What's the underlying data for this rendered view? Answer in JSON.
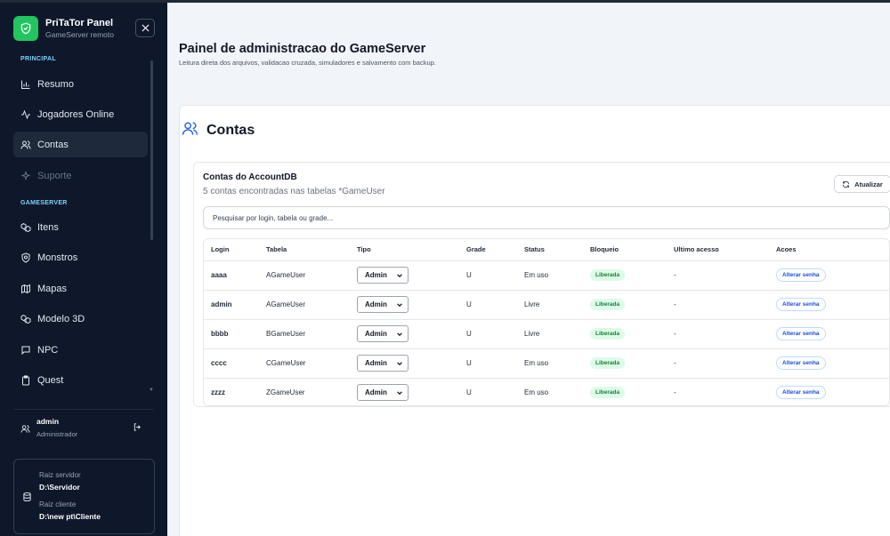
{
  "brand": {
    "title": "PriTaTor Panel",
    "subtitle": "GameServer remoto"
  },
  "sidebar": {
    "section_principal": "PRINCIPAL",
    "section_gameserver": "GAMESERVER",
    "items": [
      {
        "label": "Resumo",
        "icon": "bar-chart-icon"
      },
      {
        "label": "Jogadores Online",
        "icon": "activity-icon"
      },
      {
        "label": "Contas",
        "icon": "users-icon"
      },
      {
        "label": "Suporte",
        "icon": "sparkle-icon"
      },
      {
        "label": "Itens",
        "icon": "boxes-icon"
      },
      {
        "label": "Monstros",
        "icon": "shield-icon"
      },
      {
        "label": "Mapas",
        "icon": "map-icon"
      },
      {
        "label": "Modelo 3D",
        "icon": "boxes-icon"
      },
      {
        "label": "NPC",
        "icon": "message-icon"
      },
      {
        "label": "Quest",
        "icon": "clipboard-icon"
      }
    ],
    "user": {
      "name": "admin",
      "role": "Administrador"
    },
    "paths": {
      "server_label": "Raiz servidor",
      "server_value": "D:\\Servidor",
      "client_label": "Raiz cliente",
      "client_value": "D:\\new pt\\Cliente"
    }
  },
  "header": {
    "title": "Painel de administracao do GameServer",
    "subtitle": "Leitura direta dos arquivos, validacao cruzada, simuladores e salvamento com backup."
  },
  "card": {
    "title": "Contas"
  },
  "panel": {
    "title": "Contas do AccountDB",
    "subtitle": "5 contas encontradas nas tabelas *GameUser",
    "refresh_label": "Atualizar",
    "search_placeholder": "Pesquisar por login, tabela ou grade..."
  },
  "table": {
    "columns": [
      "Login",
      "Tabela",
      "Tipo",
      "Grade",
      "Status",
      "Bloqueio",
      "Ultimo acesso",
      "Acoes"
    ],
    "rows": [
      {
        "login": "aaaa",
        "tabela": "AGameUser",
        "tipo": "Admin",
        "grade": "U",
        "status": "Em uso",
        "bloqueio": "Liberada",
        "ultimo": "-",
        "acao": "Alterar senha"
      },
      {
        "login": "admin",
        "tabela": "AGameUser",
        "tipo": "Admin",
        "grade": "U",
        "status": "Livre",
        "bloqueio": "Liberada",
        "ultimo": "-",
        "acao": "Alterar senha"
      },
      {
        "login": "bbbb",
        "tabela": "BGameUser",
        "tipo": "Admin",
        "grade": "U",
        "status": "Livre",
        "bloqueio": "Liberada",
        "ultimo": "-",
        "acao": "Alterar senha"
      },
      {
        "login": "cccc",
        "tabela": "CGameUser",
        "tipo": "Admin",
        "grade": "U",
        "status": "Em uso",
        "bloqueio": "Liberada",
        "ultimo": "-",
        "acao": "Alterar senha"
      },
      {
        "login": "zzzz",
        "tabela": "ZGameUser",
        "tipo": "Admin",
        "grade": "U",
        "status": "Em uso",
        "bloqueio": "Liberada",
        "ultimo": "-",
        "acao": "Alterar senha"
      }
    ]
  },
  "colors": {
    "accent": "#22c55e",
    "sidebar_bg": "#0f172a",
    "link_blue": "#1d4ed8",
    "badge_green": "#dcfce7"
  }
}
